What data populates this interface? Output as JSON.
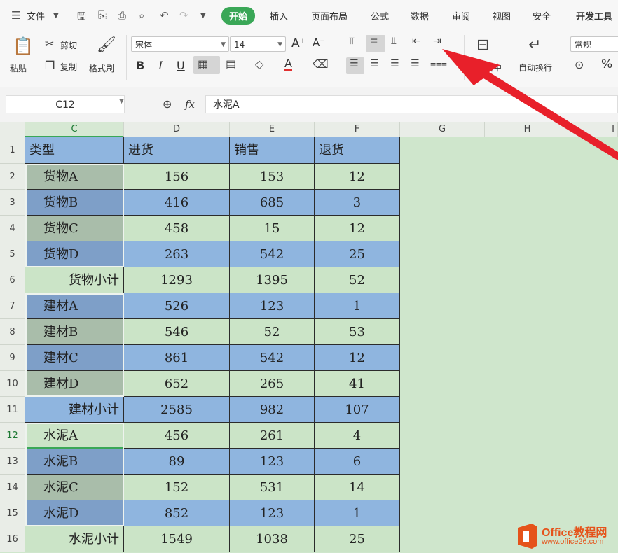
{
  "menubar": {
    "file_label": "文件",
    "tabs": [
      {
        "label": "开始",
        "active": true
      },
      {
        "label": "插入",
        "active": false
      },
      {
        "label": "页面布局",
        "active": false
      },
      {
        "label": "公式",
        "active": false
      },
      {
        "label": "数据",
        "active": false
      },
      {
        "label": "审阅",
        "active": false
      },
      {
        "label": "视图",
        "active": false
      },
      {
        "label": "安全",
        "active": false
      },
      {
        "label": "开发工具",
        "active": false
      }
    ]
  },
  "ribbon": {
    "paste_label": "粘贴",
    "cut_label": "剪切",
    "copy_label": "复制",
    "format_painter_label": "格式刷",
    "font_name": "宋体",
    "font_size": "14",
    "merge_label": "合并居中",
    "wrap_label": "自动换行",
    "number_format": "常规",
    "percent_symbol": "%",
    "bold": "B",
    "italic": "I",
    "underline": "U",
    "font_color_glyph": "A",
    "grow_font": "A⁺",
    "shrink_font": "A⁻"
  },
  "formula_bar": {
    "name_box": "C12",
    "fx_label": "fx",
    "value": "水泥A"
  },
  "columns": [
    "C",
    "D",
    "E",
    "F",
    "G",
    "H",
    "I"
  ],
  "rows": [
    {
      "num": "1",
      "cells": [
        "类型",
        "进货",
        "销售",
        "退货"
      ]
    },
    {
      "num": "2",
      "cells": [
        "货物A",
        "156",
        "153",
        "12"
      ]
    },
    {
      "num": "3",
      "cells": [
        "货物B",
        "416",
        "685",
        "3"
      ]
    },
    {
      "num": "4",
      "cells": [
        "货物C",
        "458",
        "15",
        "12"
      ]
    },
    {
      "num": "5",
      "cells": [
        "货物D",
        "263",
        "542",
        "25"
      ]
    },
    {
      "num": "6",
      "cells": [
        "货物小计",
        "1293",
        "1395",
        "52"
      ]
    },
    {
      "num": "7",
      "cells": [
        "建材A",
        "526",
        "123",
        "1"
      ]
    },
    {
      "num": "8",
      "cells": [
        "建材B",
        "546",
        "52",
        "53"
      ]
    },
    {
      "num": "9",
      "cells": [
        "建材C",
        "861",
        "542",
        "12"
      ]
    },
    {
      "num": "10",
      "cells": [
        "建材D",
        "652",
        "265",
        "41"
      ]
    },
    {
      "num": "11",
      "cells": [
        "建材小计",
        "2585",
        "982",
        "107"
      ]
    },
    {
      "num": "12",
      "cells": [
        "水泥A",
        "456",
        "261",
        "4"
      ]
    },
    {
      "num": "13",
      "cells": [
        "水泥B",
        "89",
        "123",
        "6"
      ]
    },
    {
      "num": "14",
      "cells": [
        "水泥C",
        "152",
        "531",
        "14"
      ]
    },
    {
      "num": "15",
      "cells": [
        "水泥D",
        "852",
        "123",
        "1"
      ]
    },
    {
      "num": "16",
      "cells": [
        "水泥小计",
        "1549",
        "1038",
        "25"
      ]
    }
  ],
  "watermark": {
    "title": "Office教程网",
    "url": "www.office26.com"
  },
  "colors": {
    "accent": "#3aa757",
    "sheet_green": "#cbe4c7",
    "sheet_blue": "#8fb5df",
    "arrow_red": "#e8202a"
  }
}
